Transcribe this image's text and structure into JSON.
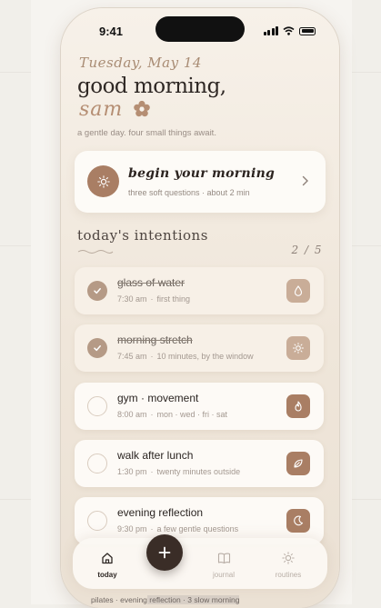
{
  "status": {
    "time": "9:41"
  },
  "header": {
    "date": "Tuesday, May 14",
    "greeting": "good morning,",
    "name": "sam",
    "subtitle": "a gentle day. four small things await."
  },
  "morning_card": {
    "title": "begin your morning",
    "subtitle": "three soft questions · about 2 min",
    "icon": "sun-icon"
  },
  "intentions": {
    "title": "today's intentions",
    "counter": "2 / 5",
    "items": [
      {
        "title": "glass of water",
        "time": "7:30 am",
        "detail": "first thing",
        "done": true,
        "icon": "water-drop-icon"
      },
      {
        "title": "morning stretch",
        "time": "7:45 am",
        "detail": "10 minutes, by the window",
        "done": true,
        "icon": "sun-icon"
      },
      {
        "title": "gym · movement",
        "time": "8:00 am",
        "detail": "mon · wed · fri · sat",
        "done": false,
        "icon": "flame-icon"
      },
      {
        "title": "walk after lunch",
        "time": "1:30 pm",
        "detail": "twenty minutes outside",
        "done": false,
        "icon": "leaf-icon"
      },
      {
        "title": "evening reflection",
        "time": "9:30 pm",
        "detail": "a few gentle questions",
        "done": false,
        "icon": "moon-icon"
      }
    ]
  },
  "peek_text": {
    "before": "pilates · evening",
    "highlight": " reflection · 3 slow morning",
    "after": ""
  },
  "tabbar": {
    "tabs": [
      {
        "label": "today",
        "icon": "home-icon",
        "active": true
      },
      {
        "label": "journal",
        "icon": "book-icon",
        "active": false
      },
      {
        "label": "routines",
        "icon": "sun-icon",
        "active": false
      }
    ],
    "add_icon": "plus-icon"
  },
  "colors": {
    "accent": "#a97e64",
    "accent_soft": "#c9ad98",
    "dark": "#3a2d27",
    "background": "#f1efea"
  }
}
